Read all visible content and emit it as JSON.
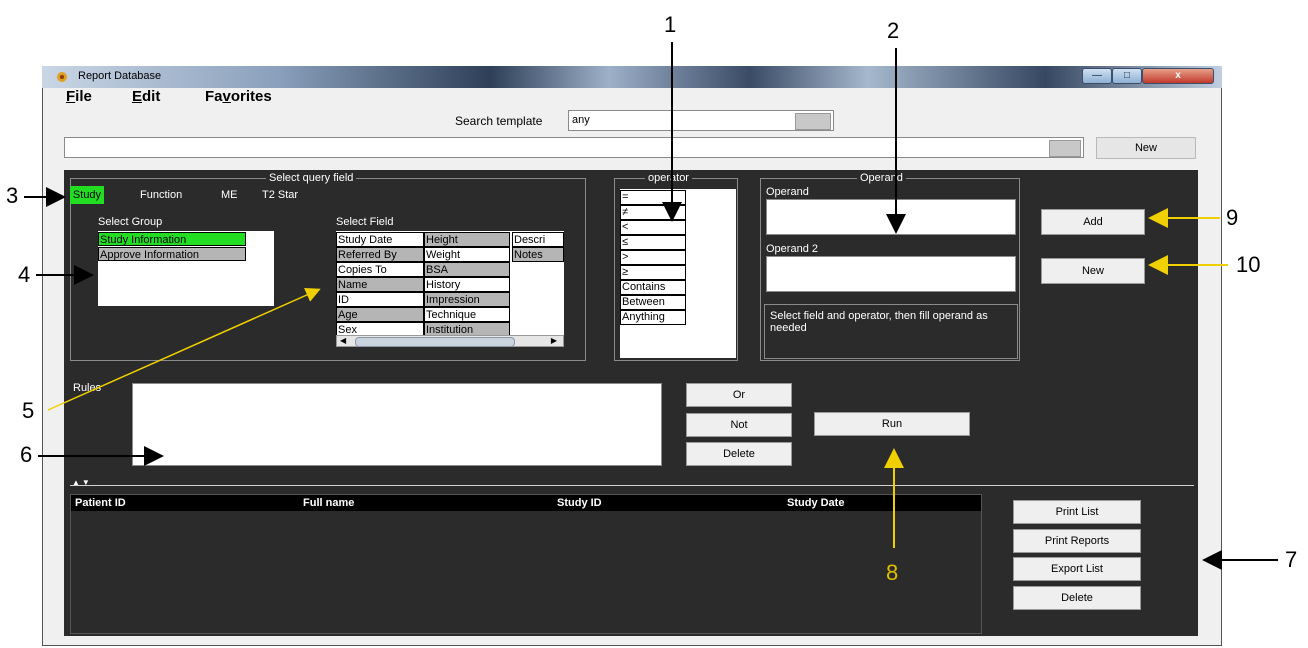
{
  "window": {
    "title": "Report Database",
    "buttons": {
      "minimize": "—",
      "maximize": "□",
      "close": "x"
    }
  },
  "menu": [
    {
      "label": "File",
      "mnemonic": "F",
      "rest": "ile"
    },
    {
      "label": "Edit",
      "mnemonic": "E",
      "rest": "dit"
    },
    {
      "label": "Favorites",
      "pre": "Fa",
      "mnemonic": "v",
      "rest": "orites"
    }
  ],
  "search": {
    "label": "Search template",
    "value": "any",
    "new_button": "New"
  },
  "query": {
    "title": "Select query field",
    "tabs": [
      "Study",
      "Function",
      "ME",
      "T2 Star"
    ],
    "active_tab": "Study",
    "group_label": "Select Group",
    "groups": [
      "Study Information",
      "Approve Information"
    ],
    "selected_group": "Study Information",
    "field_label": "Select Field",
    "fields_col1": [
      "Study Date",
      "Referred By",
      "Copies To",
      "Name",
      "ID",
      "Age",
      "Sex"
    ],
    "fields_col2": [
      "Height",
      "Weight",
      "BSA",
      "History",
      "Impression",
      "Technique",
      "Institution"
    ],
    "fields_col3": [
      "Descri",
      "Notes"
    ]
  },
  "operator": {
    "title": "operator",
    "items": [
      "=",
      "≠",
      "<",
      "≤",
      ">",
      "≥",
      "Contains",
      "Between",
      "Anything"
    ]
  },
  "operand": {
    "title": "Operand",
    "label1": "Operand",
    "label2": "Operand 2",
    "hint": "Select field and operator, then fill operand as needed",
    "add_button": "Add",
    "new_button": "New"
  },
  "rules": {
    "label": "Rules",
    "or_button": "Or",
    "not_button": "Not",
    "delete_button": "Delete",
    "run_button": "Run"
  },
  "results": {
    "columns": [
      "Patient ID",
      "Full name",
      "Study ID",
      "Study Date"
    ],
    "buttons": [
      "Print List",
      "Print Reports",
      "Export List",
      "Delete"
    ]
  },
  "callouts": {
    "c1": "1",
    "c2": "2",
    "c3": "3",
    "c4": "4",
    "c5": "5",
    "c6": "6",
    "c7": "7",
    "c8": "8",
    "c9": "9",
    "c10": "10"
  },
  "colors": {
    "highlight_green": "#22dd22",
    "annotation_yellow": "#e0c000",
    "panel_bg": "#2b2b2b"
  }
}
